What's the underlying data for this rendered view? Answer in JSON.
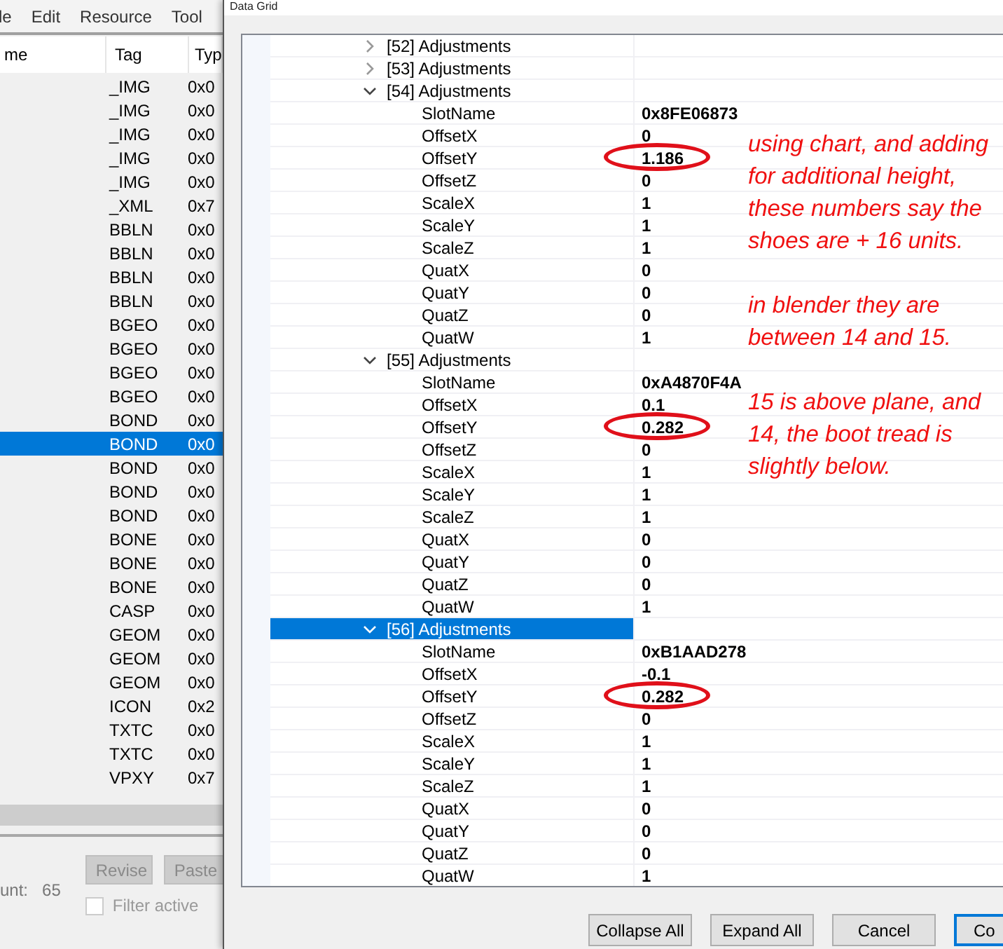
{
  "menu": [
    "le",
    "Edit",
    "Resource",
    "Tool"
  ],
  "resource_table": {
    "columns": [
      "me",
      "Tag",
      "Typ"
    ],
    "rows": [
      {
        "tag": "_IMG",
        "type": "0x0",
        "selected": false
      },
      {
        "tag": "_IMG",
        "type": "0x0",
        "selected": false
      },
      {
        "tag": "_IMG",
        "type": "0x0",
        "selected": false
      },
      {
        "tag": "_IMG",
        "type": "0x0",
        "selected": false
      },
      {
        "tag": "_IMG",
        "type": "0x0",
        "selected": false
      },
      {
        "tag": "_XML",
        "type": "0x7",
        "selected": false
      },
      {
        "tag": "BBLN",
        "type": "0x0",
        "selected": false
      },
      {
        "tag": "BBLN",
        "type": "0x0",
        "selected": false
      },
      {
        "tag": "BBLN",
        "type": "0x0",
        "selected": false
      },
      {
        "tag": "BBLN",
        "type": "0x0",
        "selected": false
      },
      {
        "tag": "BGEO",
        "type": "0x0",
        "selected": false
      },
      {
        "tag": "BGEO",
        "type": "0x0",
        "selected": false
      },
      {
        "tag": "BGEO",
        "type": "0x0",
        "selected": false
      },
      {
        "tag": "BGEO",
        "type": "0x0",
        "selected": false
      },
      {
        "tag": "BOND",
        "type": "0x0",
        "selected": false
      },
      {
        "tag": "BOND",
        "type": "0x0",
        "selected": true
      },
      {
        "tag": "BOND",
        "type": "0x0",
        "selected": false
      },
      {
        "tag": "BOND",
        "type": "0x0",
        "selected": false
      },
      {
        "tag": "BOND",
        "type": "0x0",
        "selected": false
      },
      {
        "tag": "BONE",
        "type": "0x0",
        "selected": false
      },
      {
        "tag": "BONE",
        "type": "0x0",
        "selected": false
      },
      {
        "tag": "BONE",
        "type": "0x0",
        "selected": false
      },
      {
        "tag": "CASP",
        "type": "0x0",
        "selected": false
      },
      {
        "tag": "GEOM",
        "type": "0x0",
        "selected": false
      },
      {
        "tag": "GEOM",
        "type": "0x0",
        "selected": false
      },
      {
        "tag": "GEOM",
        "type": "0x0",
        "selected": false
      },
      {
        "tag": "ICON",
        "type": "0x2",
        "selected": false
      },
      {
        "tag": "TXTC",
        "type": "0x0",
        "selected": false
      },
      {
        "tag": "TXTC",
        "type": "0x0",
        "selected": false
      },
      {
        "tag": "VPXY",
        "type": "0x7",
        "selected": false
      }
    ]
  },
  "footer": {
    "count_label": "unt:",
    "count": "65",
    "buttons": [
      {
        "label": "Revise",
        "disabled": true
      },
      {
        "label": "Paste",
        "disabled": true
      }
    ],
    "filter": {
      "label": "Filter active",
      "checked": false
    }
  },
  "dialog": {
    "title": "Data Grid",
    "grid": [
      {
        "label": "[52] Adjustments",
        "expanded": false,
        "selected": false
      },
      {
        "label": "[53] Adjustments",
        "expanded": false,
        "selected": false
      },
      {
        "label": "[54] Adjustments",
        "expanded": true,
        "selected": false,
        "children": [
          {
            "name": "SlotName",
            "value": "0x8FE06873",
            "circled": false
          },
          {
            "name": "OffsetX",
            "value": "0",
            "circled": false
          },
          {
            "name": "OffsetY",
            "value": "1.186",
            "circled": true
          },
          {
            "name": "OffsetZ",
            "value": "0",
            "circled": false
          },
          {
            "name": "ScaleX",
            "value": "1",
            "circled": false
          },
          {
            "name": "ScaleY",
            "value": "1",
            "circled": false
          },
          {
            "name": "ScaleZ",
            "value": "1",
            "circled": false
          },
          {
            "name": "QuatX",
            "value": "0",
            "circled": false
          },
          {
            "name": "QuatY",
            "value": "0",
            "circled": false
          },
          {
            "name": "QuatZ",
            "value": "0",
            "circled": false
          },
          {
            "name": "QuatW",
            "value": "1",
            "circled": false
          }
        ]
      },
      {
        "label": "[55] Adjustments",
        "expanded": true,
        "selected": false,
        "children": [
          {
            "name": "SlotName",
            "value": "0xA4870F4A",
            "circled": false
          },
          {
            "name": "OffsetX",
            "value": "0.1",
            "circled": false
          },
          {
            "name": "OffsetY",
            "value": "0.282",
            "circled": true
          },
          {
            "name": "OffsetZ",
            "value": "0",
            "circled": false
          },
          {
            "name": "ScaleX",
            "value": "1",
            "circled": false
          },
          {
            "name": "ScaleY",
            "value": "1",
            "circled": false
          },
          {
            "name": "ScaleZ",
            "value": "1",
            "circled": false
          },
          {
            "name": "QuatX",
            "value": "0",
            "circled": false
          },
          {
            "name": "QuatY",
            "value": "0",
            "circled": false
          },
          {
            "name": "QuatZ",
            "value": "0",
            "circled": false
          },
          {
            "name": "QuatW",
            "value": "1",
            "circled": false
          }
        ]
      },
      {
        "label": "[56] Adjustments",
        "expanded": true,
        "selected": true,
        "children": [
          {
            "name": "SlotName",
            "value": "0xB1AAD278",
            "circled": false
          },
          {
            "name": "OffsetX",
            "value": "-0.1",
            "circled": false
          },
          {
            "name": "OffsetY",
            "value": "0.282",
            "circled": true
          },
          {
            "name": "OffsetZ",
            "value": "0",
            "circled": false
          },
          {
            "name": "ScaleX",
            "value": "1",
            "circled": false
          },
          {
            "name": "ScaleY",
            "value": "1",
            "circled": false
          },
          {
            "name": "ScaleZ",
            "value": "1",
            "circled": false
          },
          {
            "name": "QuatX",
            "value": "0",
            "circled": false
          },
          {
            "name": "QuatY",
            "value": "0",
            "circled": false
          },
          {
            "name": "QuatZ",
            "value": "0",
            "circled": false
          },
          {
            "name": "QuatW",
            "value": "1",
            "circled": false
          }
        ]
      }
    ],
    "buttons": [
      {
        "label": "Collapse All",
        "default": false
      },
      {
        "label": "Expand All",
        "default": false
      },
      {
        "label": "Cancel",
        "default": false
      },
      {
        "label": "Co",
        "default": true
      }
    ]
  },
  "notes": [
    "using chart, and adding for additional height, these numbers say the shoes are + 16 units.",
    "in blender they are between 14 and 15.",
    "15 is above plane, and 14, the boot tread is slightly below."
  ]
}
